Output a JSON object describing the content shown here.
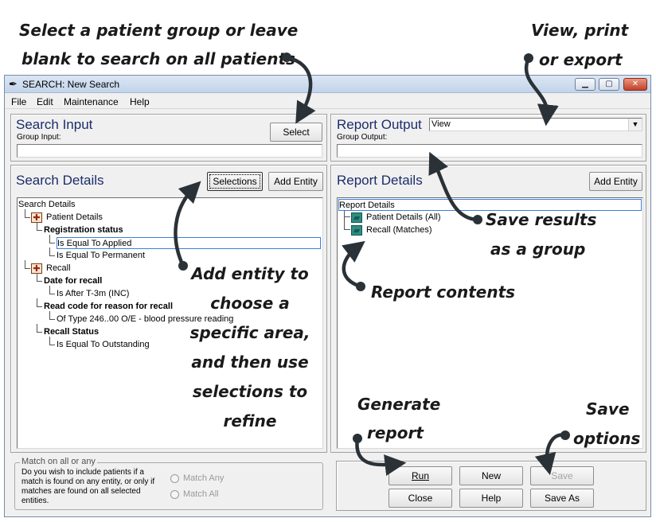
{
  "callouts": {
    "group_line1": "Select a patient group or leave",
    "group_line2": "blank to search on all patients",
    "view_line1": "View, print",
    "view_line2": "or export",
    "save_group_line1": "Save results",
    "save_group_line2": "as a group",
    "report_contents": "Report contents",
    "add_entity_lines": [
      "Add entity to",
      "choose a",
      "specific area,",
      "and then use",
      "selections to",
      "refine"
    ],
    "generate_line1": "Generate",
    "generate_line2": "report",
    "save_options_line1": "Save",
    "save_options_line2": "options"
  },
  "window": {
    "title": "SEARCH: New Search",
    "icon": "pen-icon"
  },
  "menu": [
    "File",
    "Edit",
    "Maintenance",
    "Help"
  ],
  "search_input": {
    "title": "Search Input",
    "group_label": "Group Input:",
    "group_value": "",
    "select_button": "Select"
  },
  "report_output": {
    "title": "Report Output",
    "combo_value": "View",
    "group_label": "Group Output:",
    "group_value": ""
  },
  "search_details": {
    "title": "Search Details",
    "selections_button": "Selections",
    "add_entity_button": "Add Entity",
    "tree": [
      {
        "text": "Search Details",
        "level": 0,
        "bold": false
      },
      {
        "text": "Patient Details",
        "level": 1,
        "bold": false,
        "icon": true
      },
      {
        "text": "Registration status",
        "level": 2,
        "bold": true
      },
      {
        "text": "Is Equal To Applied",
        "level": 3,
        "bold": false,
        "selected": true
      },
      {
        "text": "Is Equal To Permanent",
        "level": 3,
        "bold": false
      },
      {
        "text": "Recall",
        "level": 1,
        "bold": false,
        "icon": true
      },
      {
        "text": "Date for recall",
        "level": 2,
        "bold": true
      },
      {
        "text": "Is After T-3m (INC)",
        "level": 3,
        "bold": false
      },
      {
        "text": "Read code for reason for recall",
        "level": 2,
        "bold": true
      },
      {
        "text": "Of Type 246..00 O/E - blood pressure reading",
        "level": 3,
        "bold": false
      },
      {
        "text": "Recall Status",
        "level": 2,
        "bold": true
      },
      {
        "text": "Is Equal To Outstanding",
        "level": 3,
        "bold": false
      }
    ]
  },
  "report_details": {
    "title": "Report Details",
    "add_entity_button": "Add Entity",
    "tree_root": "Report Details",
    "items": [
      "Patient Details (All)",
      "Recall (Matches)"
    ]
  },
  "match": {
    "legend": "Match on all or any",
    "description": "Do you wish to include patients if a match is found on any entity, or only if matches are found on all selected entities.",
    "option_any": "Match Any",
    "option_all": "Match All"
  },
  "actions": {
    "run": "Run",
    "new": "New",
    "save": "Save",
    "close": "Close",
    "help": "Help",
    "save_as": "Save As"
  }
}
